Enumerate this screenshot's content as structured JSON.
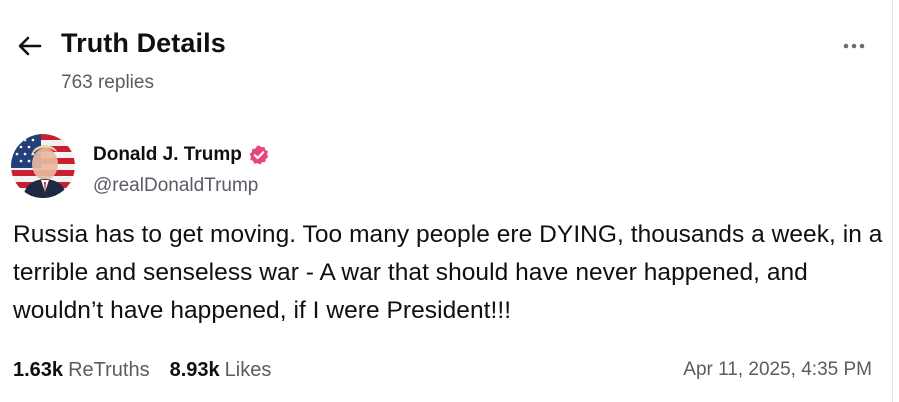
{
  "header": {
    "title": "Truth Details",
    "reply_count": "763 replies",
    "back_icon": "arrow-left-icon",
    "more_icon": "more-horizontal-icon"
  },
  "post": {
    "author": {
      "display_name": "Donald J. Trump",
      "handle": "@realDonaldTrump",
      "verified": true,
      "verified_icon": "verified-badge-icon"
    },
    "text": "Russia has to get moving. Too many people ere DYING, thousands a week, in a terrible and senseless war - A war that should have never happened, and wouldn’t have happened, if I were President!!!",
    "stats": {
      "retruths_count": "1.63k",
      "retruths_label": "ReTruths",
      "likes_count": "8.93k",
      "likes_label": "Likes"
    },
    "timestamp": "Apr 11, 2025, 4:35 PM"
  },
  "colors": {
    "text_primary": "#0f0f14",
    "text_secondary": "#5b5b66",
    "verified_badge": "#e8457a",
    "background": "#ffffff"
  }
}
